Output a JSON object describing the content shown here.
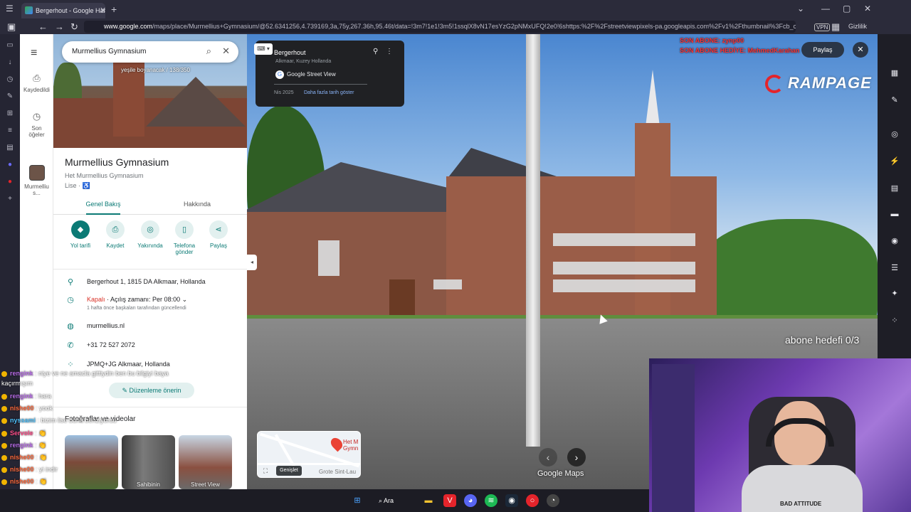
{
  "browser": {
    "tab_title": "Bergerhout - Google Harita",
    "tab_close": "✕",
    "tab_new": "+",
    "url_prefix": "www.google.com",
    "url_rest": "/maps/place/Murmellius+Gymnasium/@52.6341256,4.739169,3a,75y,267.36h,95.46t/data=!3m7!1e1!3m5!1ssqlX8vN17esYzG2pNMxUFQ!2e0!6shttps:%2F%2Fstreetviewpixels-pa.googleapis.com%2Fv1%2Fthumbnail%3Fcb_client%3...",
    "vpn_label": "VPN",
    "private_label": "Gizlilik"
  },
  "rail": {
    "saved": "Kaydedildi",
    "recent_1": "Son",
    "recent_2": "öğeler",
    "place_short_1": "Murmelliu",
    "place_short_2": "s..."
  },
  "search": {
    "value": "Murmellius Gymnasium"
  },
  "hero": {
    "photo_caption": "yeşile boyanacak / 138/350"
  },
  "place": {
    "title": "Murmellius Gymnasium",
    "subtitle": "Het Murmellius Gymnasium",
    "category": "Lise · ♿",
    "tabs": [
      "Genel Bakış",
      "Hakkında"
    ],
    "actions": [
      "Yol tarifi",
      "Kaydet",
      "Yakınında",
      "Telefona",
      "gönder",
      "Paylaş"
    ],
    "address": "Bergerhout 1, 1815 DA Alkmaar, Hollanda",
    "status_closed": "Kapalı",
    "status_opens": " · Açılış zamanı: Per 08:00",
    "status_note": "1 hafta önce başkaları tarafından güncellendi",
    "website": "murmellius.nl",
    "phone": "+31 72 527 2072",
    "plus_code": "JPMQ+JG Alkmaar, Hollanda",
    "suggest_edit": "Düzenleme önerin",
    "photos_heading": "Fotoğraflar ve videolar",
    "thumb_labels": [
      "",
      "Sahibinin",
      "Street View"
    ]
  },
  "streetview": {
    "card_title": "Bergerhout",
    "card_location": "Alkmaar, Kuzey Hollanda",
    "card_source": "Google Street View",
    "card_date": "Nis 2025",
    "card_more": "Daha fazla tarih göster",
    "share": "Paylaş",
    "close": "✕",
    "overlay_line1": "SON ABONE: zynp00",
    "overlay_line2": "SON ABONE HEDİYE: MehmedKarahan",
    "brand": "RAMPAGE",
    "goal": "abone hedefi 0/3",
    "logo": "Google Maps",
    "minimap_place_1": "Het M",
    "minimap_place_2": "Gymn",
    "minimap_street": "Grote Sint-Lau",
    "expand_tooltip": "Genişlet"
  },
  "cam": {
    "shirt_text": "BAD ATTITUDE"
  },
  "chat": [
    {
      "user": "rengink",
      "text": " : niye ve ne amacla gittiydin ben bu bilgiyi baya",
      "badge": true
    },
    {
      "user": "",
      "text": "kaçırmışım",
      "badge": false
    },
    {
      "user": "rengink",
      "text": " : hara",
      "badge": true
    },
    {
      "user": "nishe00",
      "text": " : yook",
      "badge": true
    },
    {
      "user": "nyssami",
      "text": " : bizim lise buna benziyordu",
      "badge": true
    },
    {
      "user": "Servole",
      "text": " : 👏",
      "badge": true
    },
    {
      "user": "rengink",
      "text": " : 👏",
      "badge": true
    },
    {
      "user": "nishe00",
      "text": " : 👏",
      "badge": true
    },
    {
      "user": "nishe00",
      "text": " : yi indir",
      "badge": true
    },
    {
      "user": "nishe00",
      "text": " : 👏",
      "badge": true
    },
    {
      "user": "nishe00",
      "text": " : 👏",
      "badge": true
    },
    {
      "user": "kryowei",
      "text": " : 👏",
      "badge": true
    }
  ],
  "taskbar": {
    "search": "Ara"
  },
  "colors": {
    "accent": "#0b7a75",
    "closed": "#d93025",
    "overlay_red": "#ff3030"
  }
}
